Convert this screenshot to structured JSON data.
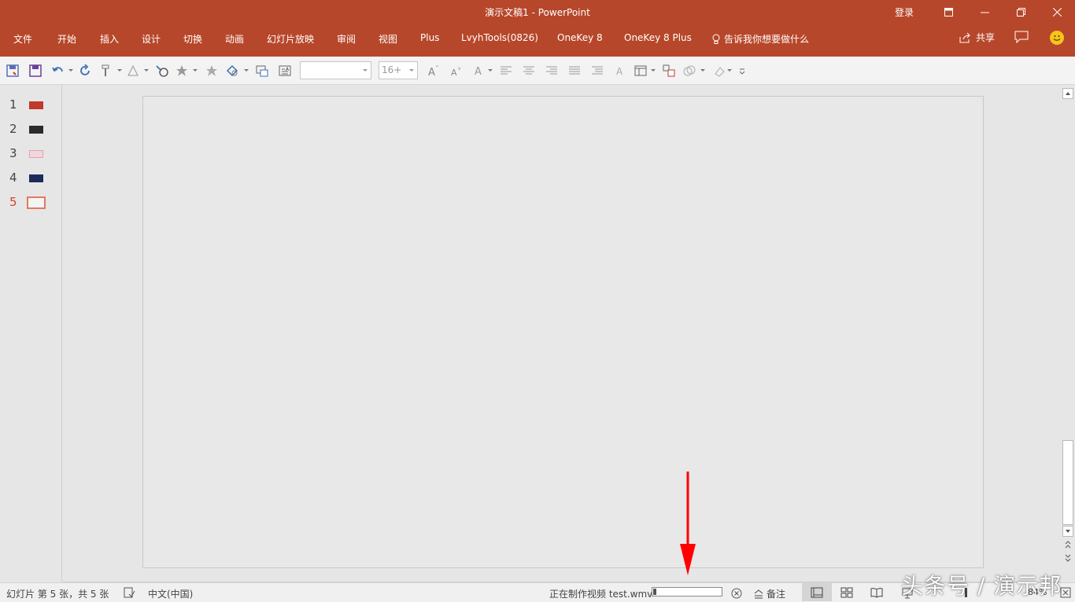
{
  "app": {
    "window_title": "演示文稿1  -  PowerPoint",
    "login_label": "登录",
    "accent_color": "#b7472a"
  },
  "ribbon": {
    "tabs": [
      "文件",
      "开始",
      "插入",
      "设计",
      "切换",
      "动画",
      "幻灯片放映",
      "审阅",
      "视图",
      "Plus",
      "LvyhTools(0826)",
      "OneKey 8",
      "OneKey 8 Plus"
    ],
    "tell_me": "告诉我你想要做什么",
    "share_label": "共享"
  },
  "toolbar": {
    "font_name_value": "",
    "font_size_value": "16+",
    "icons": [
      "save-icon",
      "save-as-icon",
      "undo-icon",
      "redo-icon",
      "format-painter-icon",
      "animation-icon",
      "effects-icon",
      "shapes-icon",
      "text-box-icon",
      "font-grow-icon",
      "font-shrink-icon",
      "font-color-icon",
      "align-left-icon",
      "align-center-icon",
      "align-right-icon",
      "justify-icon",
      "clear-format-icon"
    ]
  },
  "slides": {
    "numbers": [
      "1",
      "2",
      "3",
      "4",
      "5"
    ],
    "active_index": 5,
    "thumb_colors": [
      "#c0392b",
      "#2b2b2b",
      "#e8a0b0",
      "#1e2a5a",
      "#f4f4f4"
    ]
  },
  "status": {
    "slide_info": "幻灯片 第 5 张，共 5 张",
    "language": "中文(中国)",
    "export_text": "正在制作视频 test.wmv",
    "export_progress": 0.05,
    "notes_label": "备注",
    "zoom": "84%"
  },
  "annotation": {
    "arrow_color": "#ff0000"
  },
  "watermark": "头条号 / 演示邦"
}
